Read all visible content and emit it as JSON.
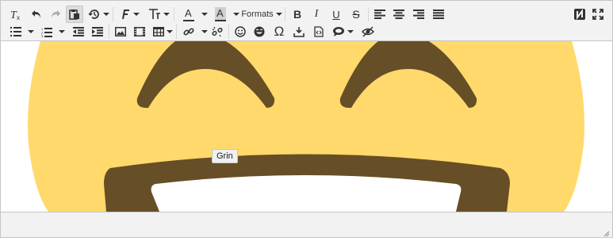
{
  "toolbar": {
    "row1": {
      "clear_formatting": "clear-formatting",
      "formats_label": "Formats",
      "bold_label": "B",
      "italic_label": "I",
      "underline_label": "U",
      "strike_label": "S",
      "forecolor_label": "A",
      "backcolor_label": "A"
    },
    "row2": {
      "special_char_label": "Ω"
    }
  },
  "tooltip": {
    "text": "Grin"
  },
  "content": {
    "emoji_name": "grinning-face-with-smiling-eyes",
    "colors": {
      "face": "#FFD56B",
      "features": "#664E27",
      "teeth": "#FFFFFF"
    }
  },
  "icons": [
    "clear-formatting-icon",
    "undo-icon",
    "redo-icon",
    "paste-icon",
    "history-icon",
    "font-family-icon",
    "font-size-icon",
    "text-color-icon",
    "background-color-icon",
    "bold-icon",
    "italic-icon",
    "underline-icon",
    "strikethrough-icon",
    "align-left-icon",
    "align-center-icon",
    "align-right-icon",
    "align-justify-icon",
    "tinymce-logo-icon",
    "fullscreen-icon",
    "bullet-list-icon",
    "numbered-list-icon",
    "outdent-icon",
    "indent-icon",
    "image-icon",
    "media-icon",
    "table-icon",
    "link-icon",
    "unlink-icon",
    "emoticons-icon",
    "emoji-icon",
    "special-character-icon",
    "insert-file-icon",
    "code-icon",
    "comment-icon",
    "visual-blocks-icon"
  ]
}
